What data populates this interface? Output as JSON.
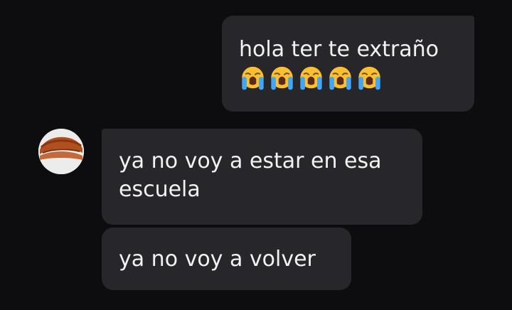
{
  "messages": {
    "sent": {
      "text": "hola ter te extraño",
      "emojis": [
        "crying-face",
        "crying-face",
        "crying-face",
        "crying-face",
        "crying-face"
      ]
    },
    "received": [
      {
        "text": "ya no voy a estar en esa escuela"
      },
      {
        "text": "ya no voy a volver"
      }
    ]
  },
  "colors": {
    "background": "#0d0d0f",
    "bubble": "#27272b",
    "text": "#f2f2f2",
    "emoji_face": "#fbc02d",
    "emoji_tears": "#42a5f5"
  },
  "avatar": {
    "icon": "avatar-brown-hair"
  }
}
